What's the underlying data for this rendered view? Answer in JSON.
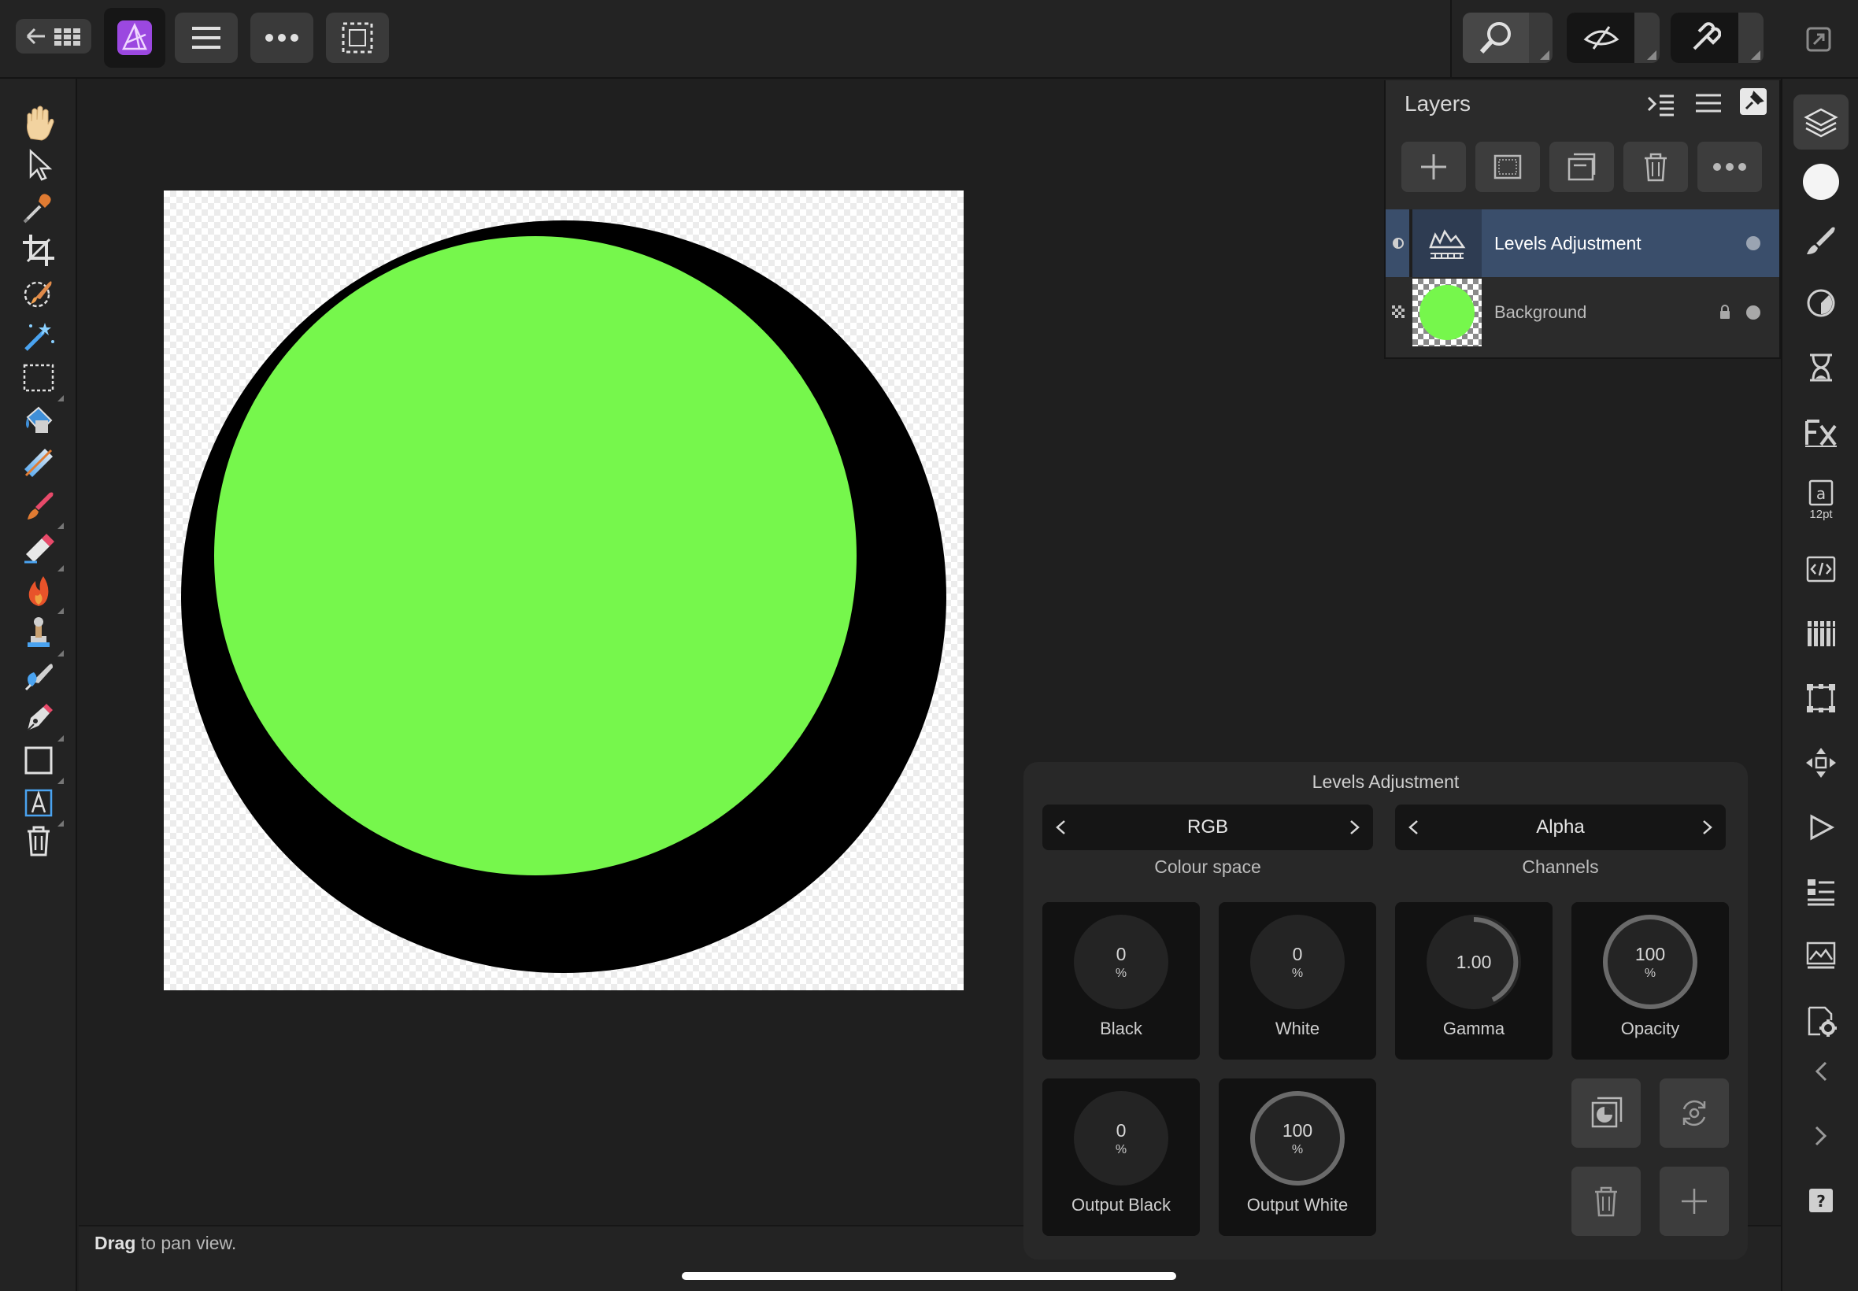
{
  "topbar": {
    "back_grid_icon": "back-grid-icon",
    "app_icon": "affinity-photo-icon",
    "menu_icon": "hamburger-icon",
    "more_icon": "more-icon",
    "selection_icon": "selection-icon",
    "zoom_icon": "zoom-icon",
    "view_icon": "view-mode-icon",
    "snap_icon": "snapping-icon",
    "expand_icon": "expand-icon"
  },
  "left_tools": [
    "hand-icon",
    "move-icon",
    "color-picker-icon",
    "crop-icon",
    "selection-brush-icon",
    "flood-select-icon",
    "marquee-icon",
    "flood-fill-icon",
    "gradient-icon",
    "paint-brush-icon",
    "erase-brush-icon",
    "dodge-burn-icon",
    "clone-icon",
    "healing-icon",
    "pen-icon",
    "rectangle-icon",
    "text-icon",
    "trash-icon"
  ],
  "right_tools": [
    "layers-icon",
    "color-icon",
    "brushes-icon",
    "adjustments-icon",
    "history-icon",
    "fx-icon",
    "text-style-icon",
    "macro-icon",
    "channels-icon",
    "transform-icon",
    "navigator-icon",
    "play-icon",
    "info-icon",
    "stock-icon",
    "settings-icon",
    "collapse-left-icon",
    "collapse-right-icon",
    "help-icon"
  ],
  "text_style_label": "12pt",
  "layers": {
    "title": "Layers",
    "rows": [
      {
        "name": "Levels Adjustment",
        "selected": true
      },
      {
        "name": "Background",
        "selected": false
      }
    ]
  },
  "levels": {
    "title": "Levels Adjustment",
    "colour_space": {
      "value": "RGB",
      "label": "Colour space"
    },
    "channels": {
      "value": "Alpha",
      "label": "Channels"
    },
    "dials": [
      {
        "label": "Black",
        "value": "0",
        "unit": "%"
      },
      {
        "label": "White",
        "value": "0",
        "unit": "%"
      },
      {
        "label": "Gamma",
        "value": "1.00",
        "unit": ""
      },
      {
        "label": "Opacity",
        "value": "100",
        "unit": "%"
      },
      {
        "label": "Output Black",
        "value": "0",
        "unit": "%"
      },
      {
        "label": "Output White",
        "value": "100",
        "unit": "%"
      }
    ]
  },
  "status": {
    "bold": "Drag",
    "rest": " to pan view."
  },
  "colors": {
    "accent_green": "#76f74c",
    "selected_layer": "#3a4e6b"
  }
}
